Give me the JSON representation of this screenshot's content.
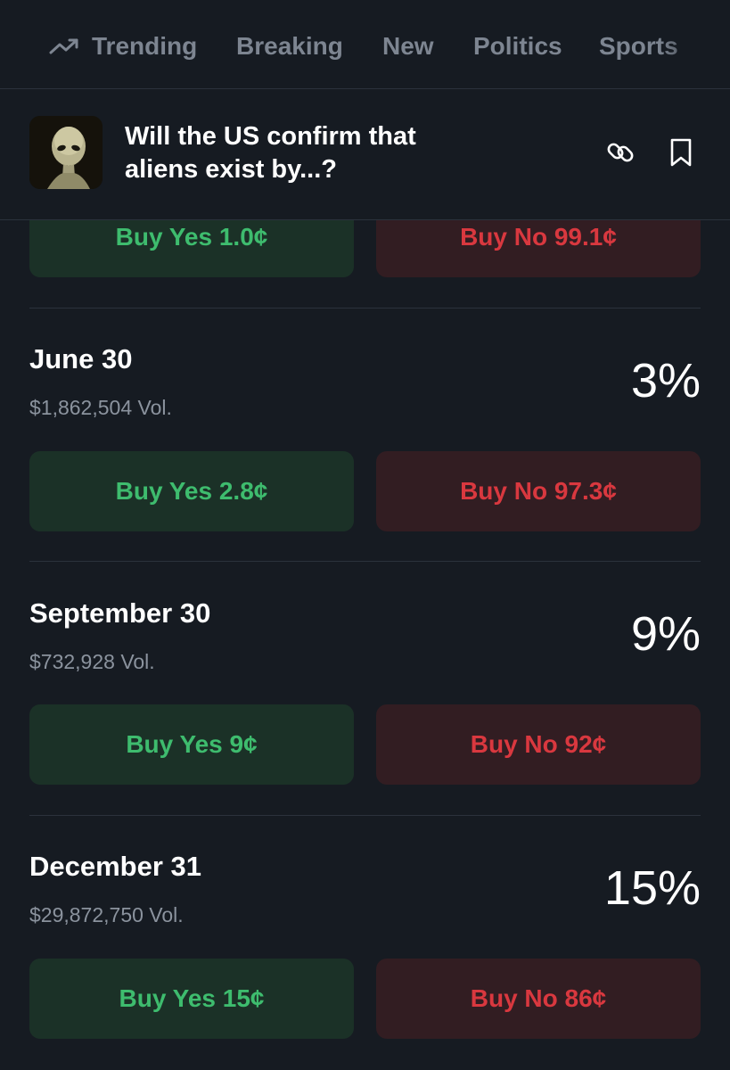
{
  "nav": {
    "trending_label": "Trending",
    "items": [
      "Breaking",
      "New",
      "Politics",
      "Sports"
    ]
  },
  "header": {
    "title_line1": "Will the US confirm that",
    "title_line2": "aliens exist by...?",
    "link_icon": "link-icon",
    "bookmark_icon": "bookmark-icon"
  },
  "partial_row": {
    "yes_label": "Buy Yes 1.0¢",
    "no_label": "Buy No 99.1¢"
  },
  "outcomes": [
    {
      "date": "June 30",
      "volume": "$1,862,504 Vol.",
      "percent": "3%",
      "yes_label": "Buy Yes 2.8¢",
      "no_label": "Buy No 97.3¢"
    },
    {
      "date": "September 30",
      "volume": "$732,928 Vol.",
      "percent": "9%",
      "yes_label": "Buy Yes 9¢",
      "no_label": "Buy No 92¢"
    },
    {
      "date": "December 31",
      "volume": "$29,872,750 Vol.",
      "percent": "15%",
      "yes_label": "Buy Yes 15¢",
      "no_label": "Buy No 86¢"
    }
  ],
  "colors": {
    "background": "#161b22",
    "yes_bg": "#1b3127",
    "yes_text": "#3ebc6e",
    "no_bg": "#321d22",
    "no_text": "#d9383f"
  }
}
